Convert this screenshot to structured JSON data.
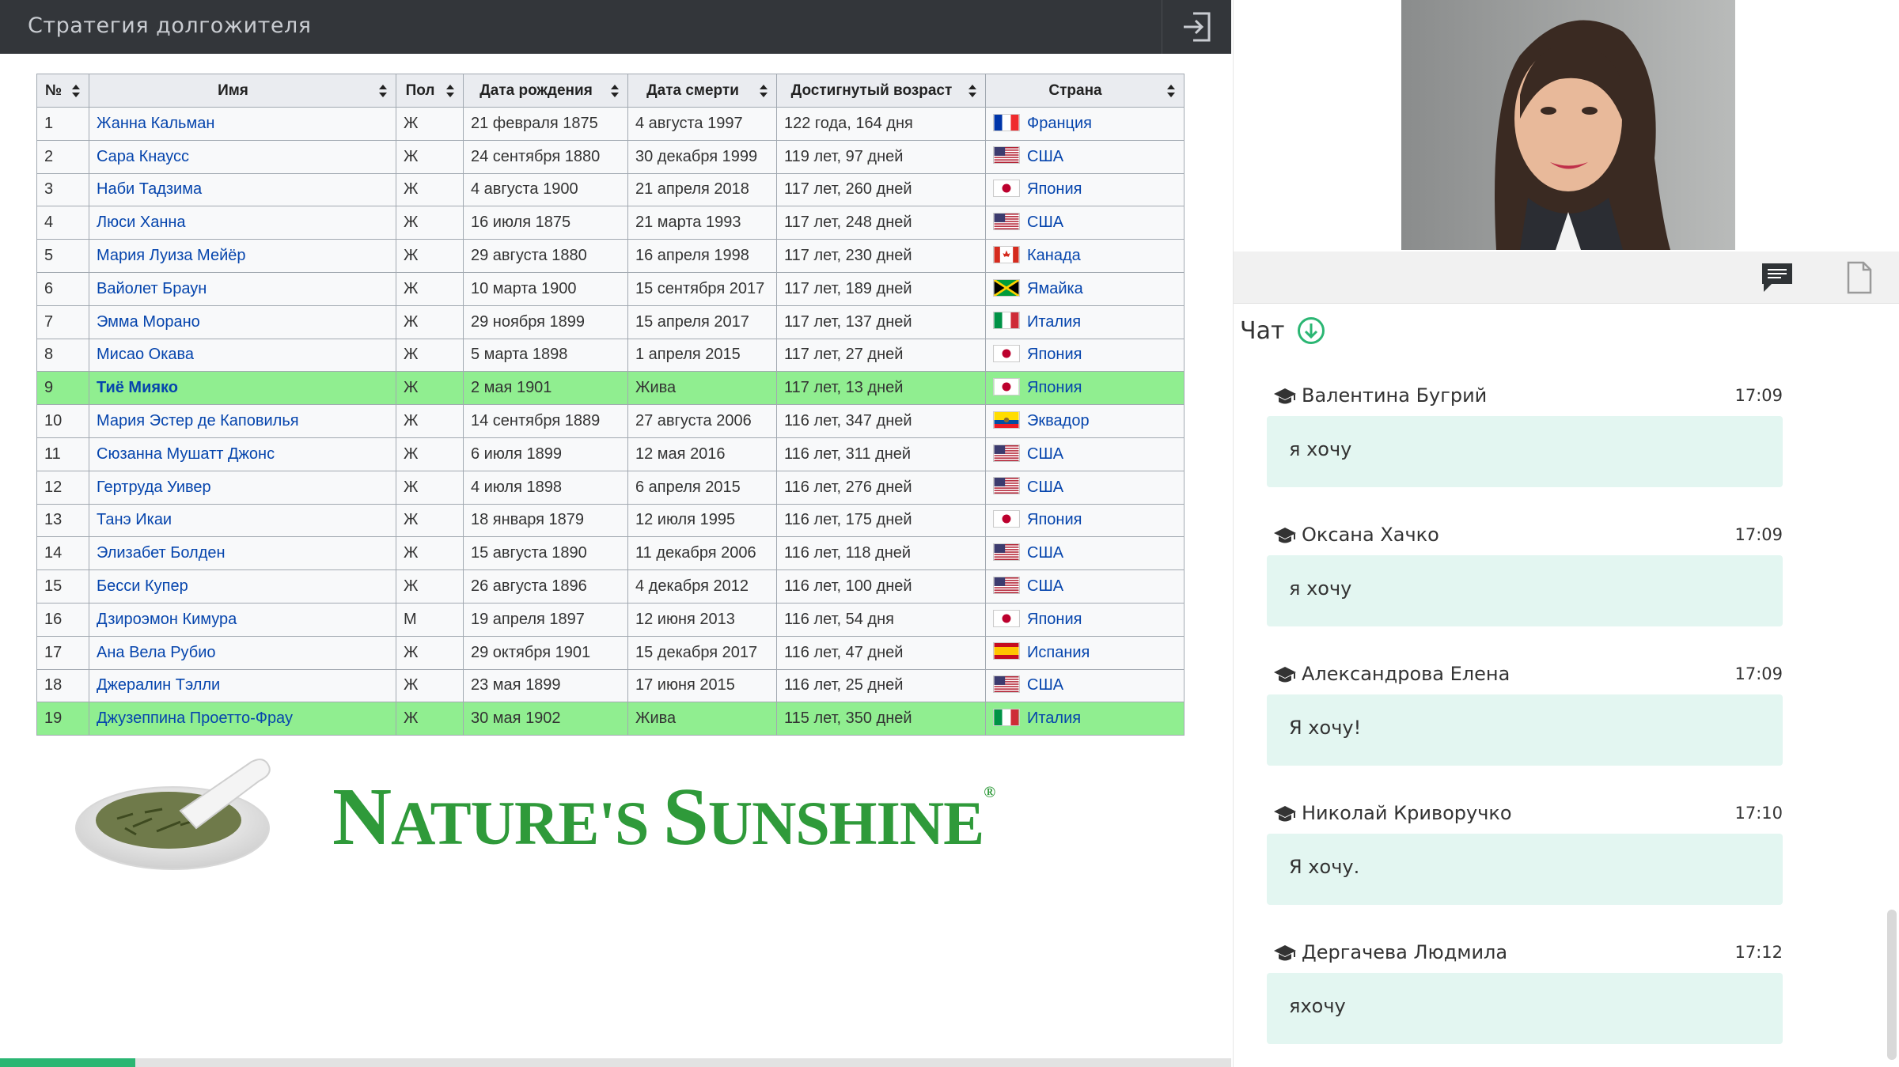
{
  "header": {
    "title": "Стратегия долгожителя"
  },
  "table": {
    "columns": [
      "№",
      "Имя",
      "Пол",
      "Дата рождения",
      "Дата смерти",
      "Достигнутый возраст",
      "Страна"
    ],
    "rows": [
      {
        "num": "1",
        "name": "Жанна Кальман",
        "sex": "Ж",
        "birth": "21 февраля 1875",
        "death": "4 августа 1997",
        "age": "122 года, 164 дня",
        "country": "Франция",
        "flag": "fr",
        "highlight": false
      },
      {
        "num": "2",
        "name": "Сара Кнаусс",
        "sex": "Ж",
        "birth": "24 сентября 1880",
        "death": "30 декабря 1999",
        "age": "119 лет, 97 дней",
        "country": "США",
        "flag": "us",
        "highlight": false
      },
      {
        "num": "3",
        "name": "Наби Тадзима",
        "sex": "Ж",
        "birth": "4 августа 1900",
        "death": "21 апреля 2018",
        "age": "117 лет, 260 дней",
        "country": "Япония",
        "flag": "jp",
        "highlight": false
      },
      {
        "num": "4",
        "name": "Люси Ханна",
        "sex": "Ж",
        "birth": "16 июля 1875",
        "death": "21 марта 1993",
        "age": "117 лет, 248 дней",
        "country": "США",
        "flag": "us",
        "highlight": false
      },
      {
        "num": "5",
        "name": "Мария Луиза Мейёр",
        "sex": "Ж",
        "birth": "29 августа 1880",
        "death": "16 апреля 1998",
        "age": "117 лет, 230 дней",
        "country": "Канада",
        "flag": "ca",
        "highlight": false
      },
      {
        "num": "6",
        "name": "Вайолет Браун",
        "sex": "Ж",
        "birth": "10 марта 1900",
        "death": "15 сентября 2017",
        "age": "117 лет, 189 дней",
        "country": "Ямайка",
        "flag": "jm",
        "highlight": false
      },
      {
        "num": "7",
        "name": "Эмма Морано",
        "sex": "Ж",
        "birth": "29 ноября 1899",
        "death": "15 апреля 2017",
        "age": "117 лет, 137 дней",
        "country": "Италия",
        "flag": "it",
        "highlight": false
      },
      {
        "num": "8",
        "name": "Мисао Окава",
        "sex": "Ж",
        "birth": "5 марта 1898",
        "death": "1 апреля 2015",
        "age": "117 лет, 27 дней",
        "country": "Япония",
        "flag": "jp",
        "highlight": false
      },
      {
        "num": "9",
        "name": "Тиё Мияко",
        "sex": "Ж",
        "birth": "2 мая 1901",
        "death": "Жива",
        "age": "117 лет, 13 дней",
        "country": "Япония",
        "flag": "jp",
        "highlight": true
      },
      {
        "num": "10",
        "name": "Мария Эстер де Каповилья",
        "sex": "Ж",
        "birth": "14 сентября 1889",
        "death": "27 августа 2006",
        "age": "116 лет, 347 дней",
        "country": "Эквадор",
        "flag": "ec",
        "highlight": false
      },
      {
        "num": "11",
        "name": "Сюзанна Мушатт Джонс",
        "sex": "Ж",
        "birth": "6 июля 1899",
        "death": "12 мая 2016",
        "age": "116 лет, 311 дней",
        "country": "США",
        "flag": "us",
        "highlight": false
      },
      {
        "num": "12",
        "name": "Гертруда Уивер",
        "sex": "Ж",
        "birth": "4 июля 1898",
        "death": "6 апреля 2015",
        "age": "116 лет, 276 дней",
        "country": "США",
        "flag": "us",
        "highlight": false
      },
      {
        "num": "13",
        "name": "Танэ Икаи",
        "sex": "Ж",
        "birth": "18 января 1879",
        "death": "12 июля 1995",
        "age": "116 лет, 175 дней",
        "country": "Япония",
        "flag": "jp",
        "highlight": false
      },
      {
        "num": "14",
        "name": "Элизабет Болден",
        "sex": "Ж",
        "birth": "15 августа 1890",
        "death": "11 декабря 2006",
        "age": "116 лет, 118 дней",
        "country": "США",
        "flag": "us",
        "highlight": false
      },
      {
        "num": "15",
        "name": "Бесси Купер",
        "sex": "Ж",
        "birth": "26 августа 1896",
        "death": "4 декабря 2012",
        "age": "116 лет, 100 дней",
        "country": "США",
        "flag": "us",
        "highlight": false
      },
      {
        "num": "16",
        "name": "Дзироэмон Кимура",
        "sex": "М",
        "birth": "19 апреля 1897",
        "death": "12 июня 2013",
        "age": "116 лет, 54 дня",
        "country": "Япония",
        "flag": "jp",
        "highlight": false
      },
      {
        "num": "17",
        "name": "Ана Вела Рубио",
        "sex": "Ж",
        "birth": "29 октября 1901",
        "death": "15 декабря 2017",
        "age": "116 лет, 47 дней",
        "country": "Испания",
        "flag": "es",
        "highlight": false
      },
      {
        "num": "18",
        "name": "Джералин Тэлли",
        "sex": "Ж",
        "birth": "23 мая 1899",
        "death": "17 июня 2015",
        "age": "116 лет, 25 дней",
        "country": "США",
        "flag": "us",
        "highlight": false
      },
      {
        "num": "19",
        "name": "Джузеппина Проетто-Фрау",
        "sex": "Ж",
        "birth": "30 мая 1902",
        "death": "Жива",
        "age": "115 лет, 350 дней",
        "country": "Италия",
        "flag": "it",
        "highlight": true
      }
    ]
  },
  "logo": {
    "brand_big_1": "N",
    "brand_small_1": "ATURE'S ",
    "brand_big_2": "S",
    "brand_small_2": "UNSHINE",
    "registered": "®"
  },
  "progress": {
    "fraction": 0.11
  },
  "colors": {
    "highlight": "#90ee90",
    "link": "#0645ad",
    "chat_bubble": "#e3f6f1",
    "accent": "#2bb673",
    "topbar": "#33363a"
  },
  "chat": {
    "title": "Чат",
    "messages": [
      {
        "author": "Валентина Бугрий",
        "time": "17:09",
        "text": "я хочу"
      },
      {
        "author": "Оксана Хачко",
        "time": "17:09",
        "text": "я хочу"
      },
      {
        "author": "Александрова Елена",
        "time": "17:09",
        "text": "Я хочу!"
      },
      {
        "author": "Николай Криворучко",
        "time": "17:10",
        "text": "Я хочу."
      },
      {
        "author": "Дергачева Людмила",
        "time": "17:12",
        "text": "яхочу"
      }
    ]
  },
  "icons": [
    "exit-icon",
    "sort-icon",
    "chat-icon",
    "document-icon",
    "download-icon",
    "graduation-cap-icon"
  ]
}
